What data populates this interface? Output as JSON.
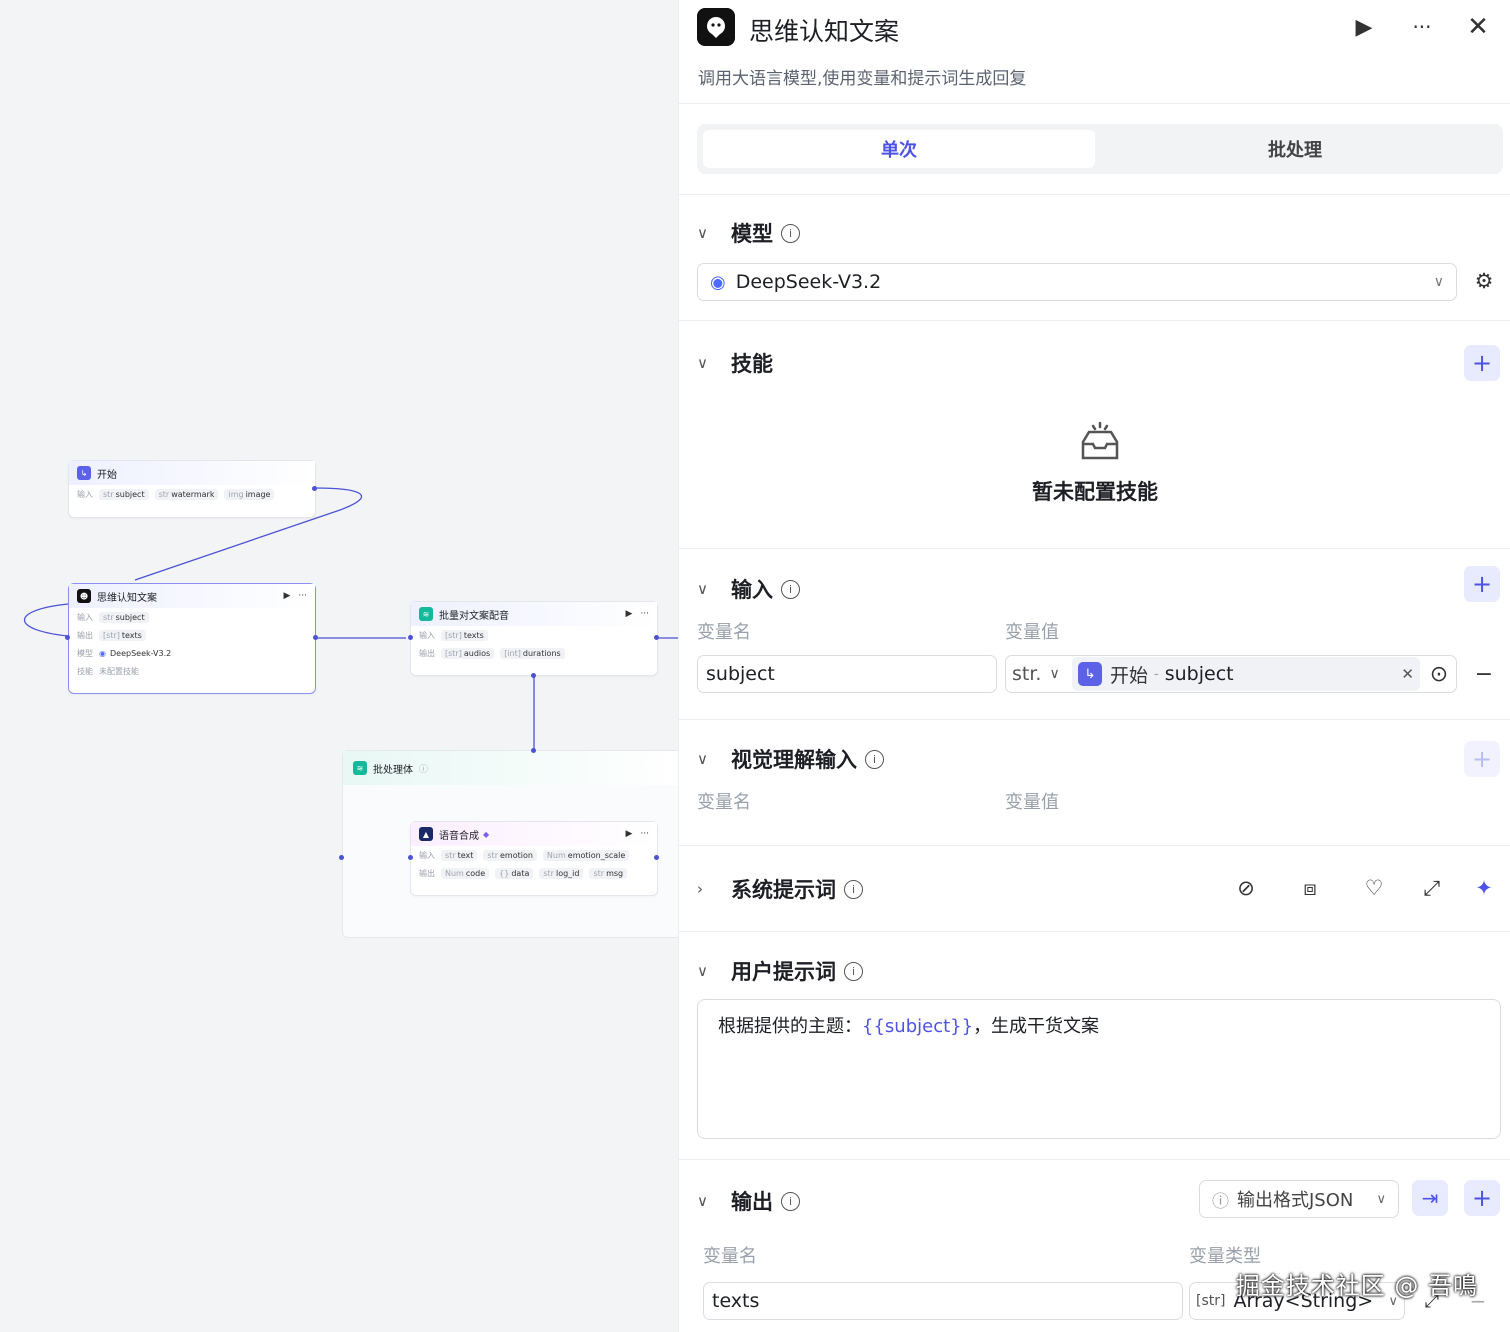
{
  "canvas": {
    "start_node": {
      "title": "开始",
      "in_label": "输入",
      "tags": [
        {
          "type": "str",
          "name": "subject"
        },
        {
          "type": "str",
          "name": "watermark"
        },
        {
          "type": "img",
          "name": "image"
        }
      ]
    },
    "think_node": {
      "title": "思维认知文案",
      "in_label": "输入",
      "out_label": "输出",
      "model_label": "模型",
      "skill_label": "技能",
      "in_tags": [
        {
          "type": "str",
          "name": "subject"
        }
      ],
      "out_tags": [
        {
          "type": "[str]",
          "name": "texts"
        }
      ],
      "model": "DeepSeek-V3.2",
      "skill": "未配置技能"
    },
    "dub_node": {
      "title": "批量对文案配音",
      "in_label": "输入",
      "out_label": "输出",
      "in_tags": [
        {
          "type": "[str]",
          "name": "texts"
        }
      ],
      "out_tags": [
        {
          "type": "[str]",
          "name": "audios"
        },
        {
          "type": "[int]",
          "name": "durations"
        }
      ]
    },
    "batch_node": {
      "title": "批处理体"
    },
    "tts_node": {
      "title": "语音合成",
      "in_label": "输入",
      "out_label": "输出",
      "in_tags": [
        {
          "type": "str",
          "name": "text"
        },
        {
          "type": "str",
          "name": "emotion"
        },
        {
          "type": "Num",
          "name": "emotion_scale"
        }
      ],
      "out_tags": [
        {
          "type": "Num",
          "name": "code"
        },
        {
          "type": "{}",
          "name": "data"
        },
        {
          "type": "str",
          "name": "log_id"
        },
        {
          "type": "str",
          "name": "msg"
        }
      ]
    }
  },
  "panel": {
    "title": "思维认知文案",
    "description": "调用大语言模型,使用变量和提示词生成回复",
    "tabs": {
      "single": "单次",
      "batch": "批处理"
    },
    "model": {
      "section": "模型",
      "value": "DeepSeek-V3.2"
    },
    "skills": {
      "section": "技能",
      "empty": "暂未配置技能"
    },
    "input": {
      "section": "输入",
      "col_name": "变量名",
      "col_value": "变量值",
      "var_name": "subject",
      "var_type": "str.",
      "ref_node": "开始",
      "ref_sep": "-",
      "ref_var": "subject"
    },
    "visual_input": {
      "section": "视觉理解输入",
      "col_name": "变量名",
      "col_value": "变量值"
    },
    "system_prompt": {
      "section": "系统提示词"
    },
    "user_prompt": {
      "section": "用户提示词",
      "before": "根据提供的主题：",
      "var": "{{subject}}",
      "after": "，生成干货文案"
    },
    "output": {
      "section": "输出",
      "format": "输出格式JSON",
      "col_name": "变量名",
      "col_type": "变量类型",
      "var_name": "texts",
      "var_type": "Array<String>",
      "type_icon": "[str]"
    }
  },
  "watermark": "掘金技术社区 @ 吾鳴",
  "colors": {
    "accent": "#4d53e8",
    "node_selected": "#8c8ff0"
  }
}
